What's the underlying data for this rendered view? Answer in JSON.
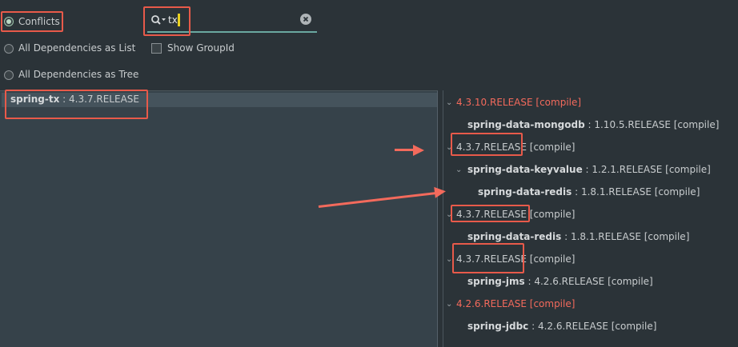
{
  "view_options": {
    "conflicts_label": "Conflicts",
    "all_list_label": "All Dependencies as List",
    "all_tree_label": "All Dependencies as Tree",
    "show_groupid_label": "Show GroupId"
  },
  "search": {
    "value": "tx"
  },
  "left_list": [
    {
      "name": "spring-tx",
      "version": " : 4.3.7.RELEASE"
    }
  ],
  "tree": [
    {
      "text": "4.3.10.RELEASE [compile]"
    },
    {
      "name": "spring-data-mongodb",
      "version": " : 1.10.5.RELEASE [compile]"
    },
    {
      "version_boxed": "4.3.7.RELEASE",
      "scope": " [compile]"
    },
    {
      "name": "spring-data-keyvalue",
      "version": " : 1.2.1.RELEASE [compile]"
    },
    {
      "name": "spring-data-redis",
      "version": " : 1.8.1.RELEASE [compile]"
    },
    {
      "version_boxed": "4.3.7.RELEASE",
      "scope": " [compile]"
    },
    {
      "name": "spring-data-redis",
      "version": " : 1.8.1.RELEASE [compile]"
    },
    {
      "version_boxed": "4.3.7.RELEASE",
      "scope": " [compile]"
    },
    {
      "name": "spring-jms",
      "version": " : 4.2.6.RELEASE [compile]"
    },
    {
      "text": "4.2.6.RELEASE [compile]"
    },
    {
      "name": "spring-jdbc",
      "version": " : 4.2.6.RELEASE [compile]"
    }
  ],
  "colors": {
    "accent_red": "#f36a5c",
    "background": "#2b3338",
    "left_panel": "#36424a"
  }
}
